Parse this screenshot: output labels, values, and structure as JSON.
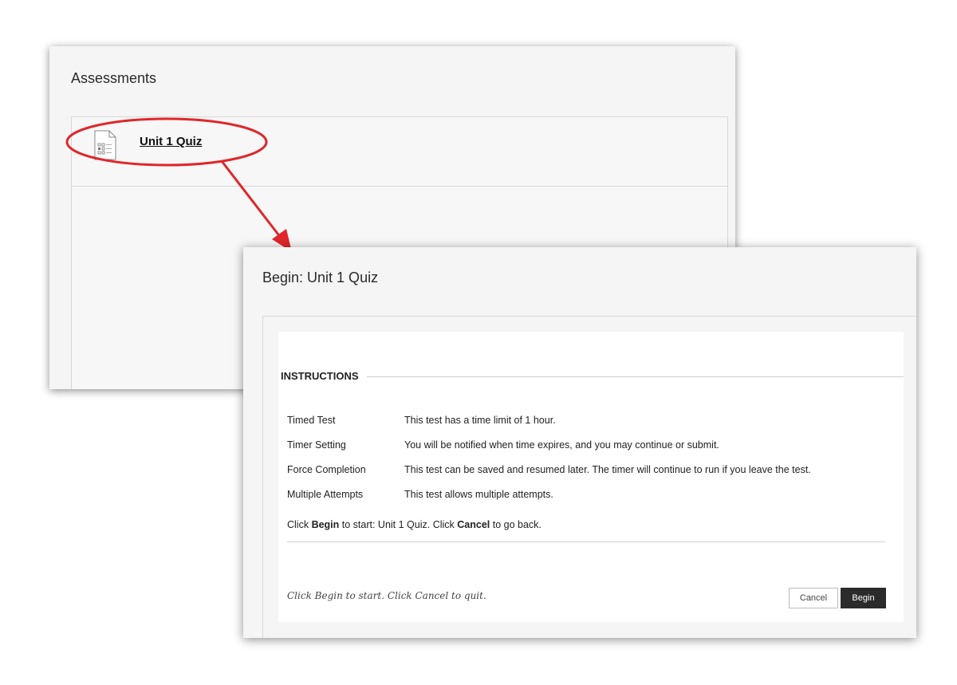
{
  "assessments": {
    "title": "Assessments",
    "items": [
      {
        "label": "Unit 1 Quiz",
        "icon": "quiz-document-icon"
      }
    ]
  },
  "annotation": {
    "color": "#e0262a",
    "shapes": [
      "ellipse-highlight",
      "arrow"
    ]
  },
  "dialog": {
    "title": "Begin: Unit 1 Quiz",
    "instructions_heading": "INSTRUCTIONS",
    "rows": [
      {
        "label": "Timed Test",
        "value": "This test has a time limit of 1 hour."
      },
      {
        "label": "Timer Setting",
        "value": "You will be notified when time expires, and you may continue or submit."
      },
      {
        "label": "Force Completion",
        "value": "This test can be saved and resumed later. The timer will continue to run if you leave the test."
      },
      {
        "label": "Multiple Attempts",
        "value": "This test allows multiple attempts."
      }
    ],
    "begin_line": {
      "prefix": "Click ",
      "begin": "Begin",
      "middle": " to start: Unit 1 Quiz. Click ",
      "cancel": "Cancel",
      "suffix": " to go back."
    },
    "footer_hint": "Click Begin to start. Click Cancel to quit.",
    "cancel_label": "Cancel",
    "begin_label": "Begin"
  }
}
